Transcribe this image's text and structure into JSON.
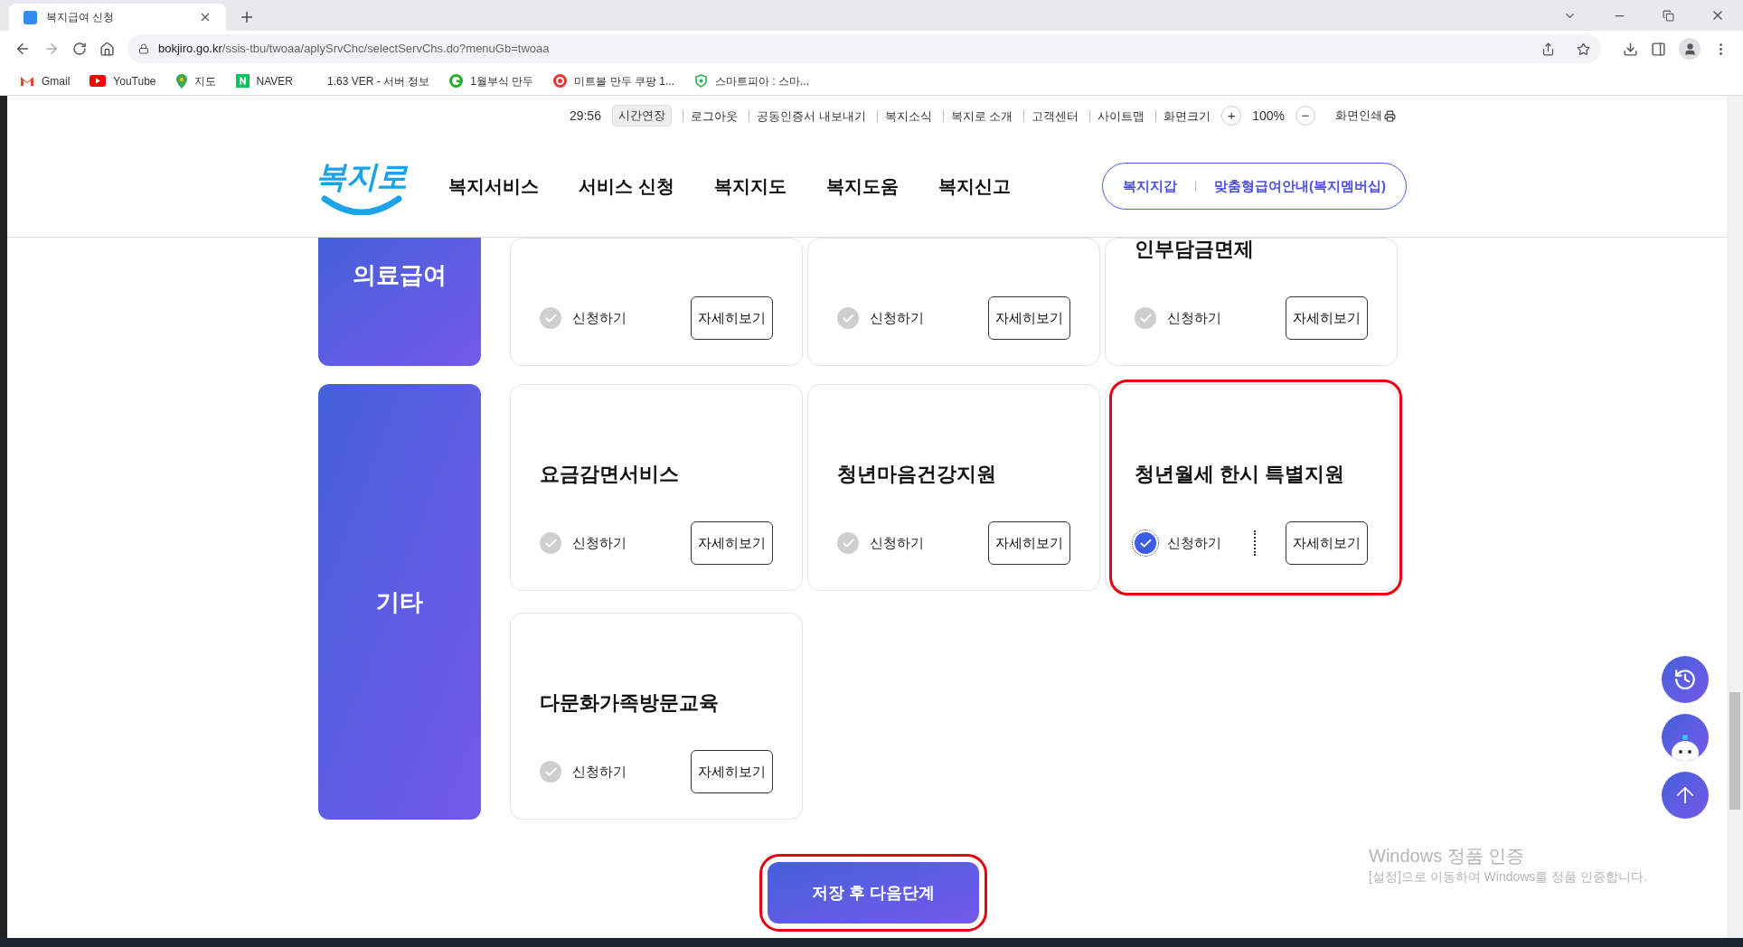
{
  "browser": {
    "tab_title": "복지급여 신청",
    "url_host": "bokjiro.go.kr",
    "url_path": "/ssis-tbu/twoaa/aplySrvChc/selectServChs.do?menuGb=twoaa",
    "bookmarks": [
      {
        "label": "Gmail",
        "kind": "gmail"
      },
      {
        "label": "YouTube",
        "kind": "youtube"
      },
      {
        "label": "지도",
        "kind": "maps"
      },
      {
        "label": "NAVER",
        "kind": "naver"
      },
      {
        "label": "1.63 VER - 서버 정보",
        "kind": "none"
      },
      {
        "label": "1월부식 만두",
        "kind": "g"
      },
      {
        "label": "미트볼 만두 쿠팡 1...",
        "kind": "c"
      },
      {
        "label": "스마트피아 : 스마...",
        "kind": "w"
      }
    ]
  },
  "utility": {
    "timer": "29:56",
    "extend": "시간연장",
    "links": [
      "로그아웃",
      "공동인증서 내보내기",
      "복지소식",
      "복지로 소개",
      "고객센터",
      "사이트맵"
    ],
    "zoom_label": "화면크기",
    "zoom_plus": "+",
    "zoom": "100%",
    "zoom_minus": "−",
    "print": "화면인쇄"
  },
  "header": {
    "logo": "복지로",
    "menu": [
      "복지서비스",
      "서비스 신청",
      "복지지도",
      "복지도움",
      "복지신고"
    ],
    "pills": [
      "복지지갑",
      "맞춤형급여안내(복지멤버십)"
    ]
  },
  "sections": [
    {
      "category": "의료급여",
      "clipped": true,
      "cards": [
        {
          "checked": false,
          "highlighted": false,
          "apply": "신청하기",
          "details": "자세히보기"
        },
        {
          "checked": false,
          "highlighted": false,
          "apply": "신청하기",
          "details": "자세히보기"
        },
        {
          "title": "인부담금면제",
          "checked": false,
          "highlighted": false,
          "apply": "신청하기",
          "details": "자세히보기"
        }
      ]
    },
    {
      "category": "기타",
      "clipped": false,
      "cards": [
        {
          "title": "요금감면서비스",
          "checked": false,
          "highlighted": false,
          "apply": "신청하기",
          "details": "자세히보기"
        },
        {
          "title": "청년마음건강지원",
          "checked": false,
          "highlighted": false,
          "apply": "신청하기",
          "details": "자세히보기"
        },
        {
          "title": "청년월세 한시 특별지원",
          "checked": true,
          "highlighted": true,
          "apply": "신청하기",
          "details": "자세히보기"
        },
        {
          "title": "다문화가족방문교육",
          "checked": false,
          "highlighted": false,
          "apply": "신청하기",
          "details": "자세히보기"
        }
      ]
    }
  ],
  "save_button": {
    "label": "저장 후 다음단계",
    "highlighted": true
  },
  "os_notice": {
    "title": "Windows 정품 인증",
    "text": "[설정]으로 이동하여 Windows를 정품 인증합니다."
  }
}
